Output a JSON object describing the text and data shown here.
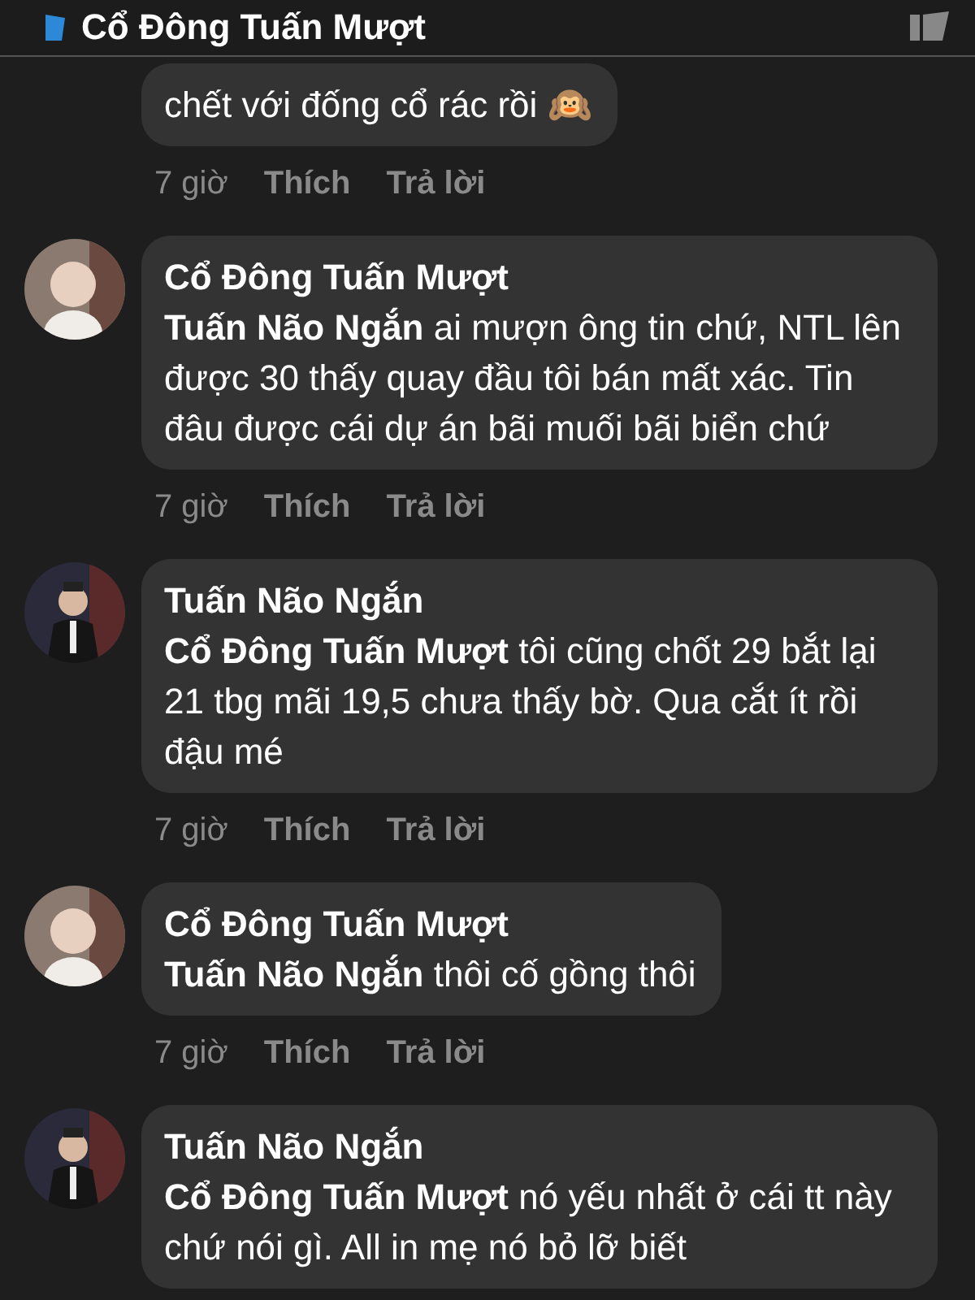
{
  "header": {
    "title": "Cổ Đông Tuấn Mượt"
  },
  "comments": [
    {
      "text": "chết với đống cổ rác rồi 🙉",
      "time": "7 giờ",
      "like": "Thích",
      "reply": "Trả lời"
    },
    {
      "author": "Cổ Đông Tuấn Mượt",
      "mention": "Tuấn Não Ngắn",
      "text": "ai mượn ông tin chứ, NTL lên được 30 thấy quay đầu tôi bán mất xác. Tin đâu được cái dự án bãi muối bãi biển chứ",
      "time": "7 giờ",
      "like": "Thích",
      "reply": "Trả lời"
    },
    {
      "author": "Tuấn Não Ngắn",
      "mention": "Cổ Đông Tuấn Mượt",
      "text": "tôi cũng chốt 29 bắt lại 21 tbg mãi 19,5 chưa thấy bờ. Qua cắt ít rồi đậu mé",
      "time": "7 giờ",
      "like": "Thích",
      "reply": "Trả lời"
    },
    {
      "author": "Cổ Đông Tuấn Mượt",
      "mention": "Tuấn Não Ngắn",
      "text": "thôi cố gồng thôi",
      "time": "7 giờ",
      "like": "Thích",
      "reply": "Trả lời"
    },
    {
      "author": "Tuấn Não Ngắn",
      "mention": "Cổ Đông Tuấn Mượt",
      "text": "nó yếu nhất ở cái tt này chứ nói gì. All in mẹ nó bỏ lỡ biết"
    }
  ]
}
